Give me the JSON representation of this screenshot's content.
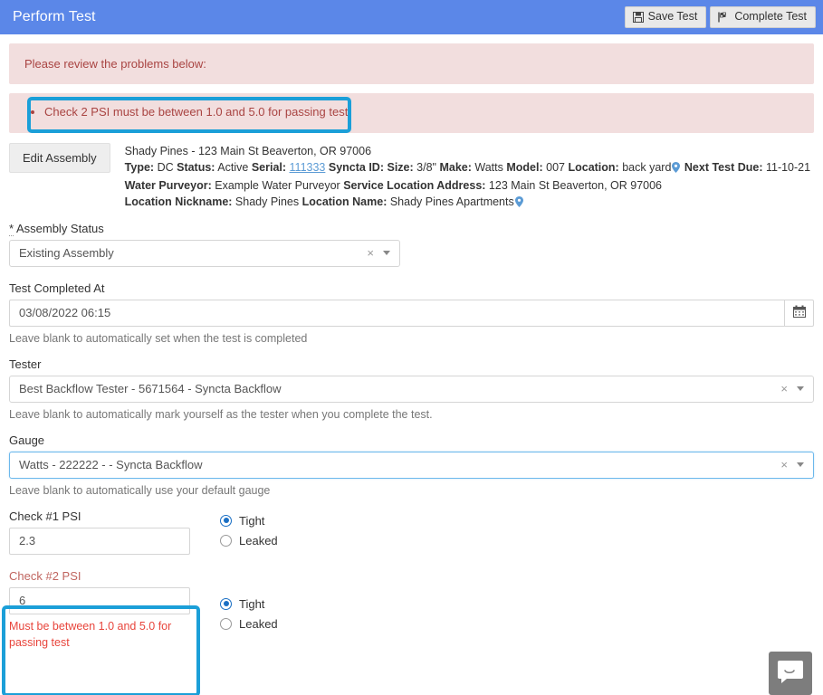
{
  "header": {
    "title": "Perform Test",
    "save_label": "Save Test",
    "complete_label": "Complete Test"
  },
  "alerts": {
    "summary": "Please review the problems below:",
    "problems": [
      "Check 2 PSI must be between 1.0 and 5.0 for passing test"
    ]
  },
  "assembly": {
    "edit_label": "Edit Assembly",
    "title": "Shady Pines - 123 Main St Beaverton, OR 97006",
    "line2": {
      "type_label": "Type:",
      "type_value": "DC",
      "status_label": "Status:",
      "status_value": "Active",
      "serial_label": "Serial:",
      "serial_value": "111333",
      "syncta_label": "Syncta ID:",
      "syncta_value": "",
      "size_label": "Size:",
      "size_value": "3/8\"",
      "make_label": "Make:",
      "make_value": "Watts",
      "model_label": "Model:",
      "model_value": "007",
      "location_label": "Location:",
      "location_value": "back yard",
      "next_test_label": "Next Test Due:",
      "next_test_value": "11-10-21"
    },
    "line3": {
      "purveyor_label": "Water Purveyor:",
      "purveyor_value": "Example Water Purveyor",
      "service_addr_label": "Service Location Address:",
      "service_addr_value": "123 Main St Beaverton, OR 97006"
    },
    "line4": {
      "nickname_label": "Location Nickname:",
      "nickname_value": "Shady Pines",
      "locname_label": "Location Name:",
      "locname_value": "Shady Pines Apartments"
    }
  },
  "form": {
    "assembly_status": {
      "required_marker": "*",
      "label": "Assembly Status",
      "value": "Existing Assembly",
      "clear": "×"
    },
    "test_completed_at": {
      "label": "Test Completed At",
      "value": "03/08/2022 06:15",
      "placeholder": "",
      "help": "Leave blank to automatically set when the test is completed"
    },
    "tester": {
      "label": "Tester",
      "value": "Best Backflow Tester - 5671564 - Syncta Backflow",
      "clear": "×",
      "help": "Leave blank to automatically mark yourself as the tester when you complete the test."
    },
    "gauge": {
      "label": "Gauge",
      "value": "Watts - 222222 - - Syncta Backflow",
      "clear": "×",
      "help": "Leave blank to automatically use your default gauge"
    },
    "check1": {
      "label": "Check #1 PSI",
      "value": "2.3",
      "tight_label": "Tight",
      "leaked_label": "Leaked",
      "selected": "Tight"
    },
    "check2": {
      "label": "Check #2 PSI",
      "value": "6",
      "error": "Must be between 1.0 and 5.0 for passing test",
      "tight_label": "Tight",
      "leaked_label": "Leaked",
      "selected": "Tight"
    }
  },
  "chat": {
    "icon": "chat-bubble-icon"
  },
  "colors": {
    "header_bg": "#5b87e8",
    "alert_bg": "#f2dede",
    "alert_text": "#a94442",
    "annotation": "#1b9fd8",
    "link": "#5b9bd5",
    "error_text": "#e8453c",
    "radio_selected": "#1a6fc4"
  }
}
